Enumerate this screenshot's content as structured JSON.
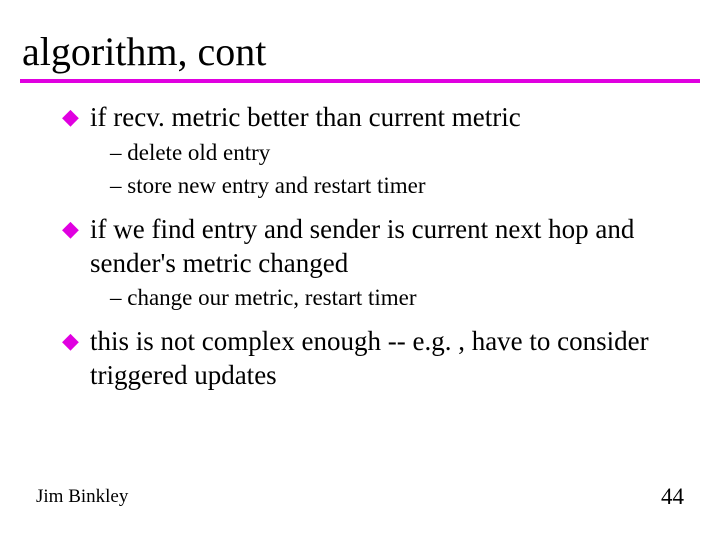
{
  "title": "algorithm, cont",
  "bullets": {
    "b1": "if recv. metric better than current metric",
    "b1s1": "delete old entry",
    "b1s2": "store new entry and restart timer",
    "b2": "if we find entry and sender is current next hop and sender's metric changed",
    "b2s1": "change our metric, restart timer",
    "b3": "this is not complex enough -- e.g. , have to consider triggered updates"
  },
  "footer": {
    "author": "Jim Binkley",
    "page": "44"
  }
}
